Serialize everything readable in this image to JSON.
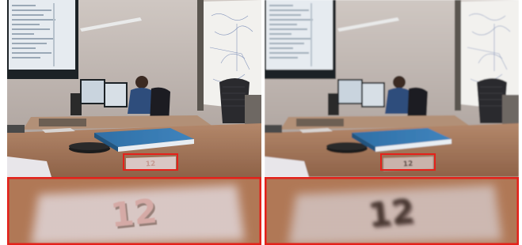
{
  "panels": [
    {
      "id": "left",
      "paper_label": "12",
      "zoom_label": "12",
      "note_fill": "#d9c7c4",
      "label_color": "#c49a92",
      "zoom_label_color": "#d5aaa6",
      "zoom_shadow": "#6a4f45",
      "zoom_blur": 0.6,
      "scene_blur": 0.25,
      "frame_color": "#e4211a"
    },
    {
      "id": "right",
      "paper_label": "12",
      "zoom_label": "12",
      "note_fill": "#c9b3ab",
      "label_color": "#4d3b35",
      "zoom_label_color": "#4a3830",
      "zoom_shadow": "#5c4740",
      "zoom_blur": 2.2,
      "scene_blur": 0.7,
      "frame_color": "#e4211a"
    }
  ]
}
